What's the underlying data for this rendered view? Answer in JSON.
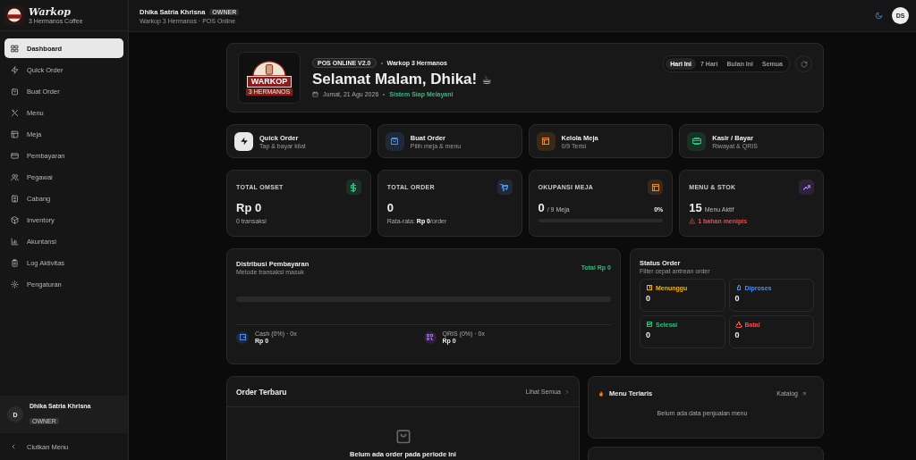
{
  "sidebar": {
    "brand": {
      "title": "Warkop",
      "subtitle": "3 Hermanos Coffee"
    },
    "items": [
      {
        "label": "Dashboard",
        "selected": true
      },
      {
        "label": "Quick Order",
        "selected": false
      },
      {
        "label": "Buat Order",
        "selected": false
      },
      {
        "label": "Menu",
        "selected": false
      },
      {
        "label": "Meja",
        "selected": false
      },
      {
        "label": "Pembayaran",
        "selected": false
      },
      {
        "label": "Pegawai",
        "selected": false
      },
      {
        "label": "Cabang",
        "selected": false
      },
      {
        "label": "Inventory",
        "selected": false
      },
      {
        "label": "Akuntansi",
        "selected": false
      },
      {
        "label": "Log Aktivitas",
        "selected": false
      },
      {
        "label": "Pengaturan",
        "selected": false
      }
    ],
    "user": {
      "initial": "D",
      "name": "Dhika Satria Khrisna",
      "role": "OWNER"
    },
    "collapse": {
      "label": "Ciutkan Menu"
    }
  },
  "header": {
    "name": "Dhika Satria Khrisna",
    "role": "OWNER",
    "subtitle": "Warkop 3 Hermanos · POS Online",
    "avatar": "DS"
  },
  "hero": {
    "logo": {
      "title": "WARKOP",
      "subtitle": "3 HERMANOS"
    },
    "badge": "POS ONLINE V2.0",
    "org": "Warkop 3 Hermanos",
    "greeting": "Selamat Malam, Dhika!",
    "emoji": "☕",
    "date": "Jumat, 21 Agu 2026",
    "status": "Sistem Siap Melayani",
    "ranges": [
      {
        "label": "Hari Ini",
        "selected": true
      },
      {
        "label": "7 Hari",
        "selected": false
      },
      {
        "label": "Bulan Ini",
        "selected": false
      },
      {
        "label": "Semua",
        "selected": false
      }
    ]
  },
  "quick_actions": [
    {
      "title": "Quick Order",
      "subtitle": "Tap & bayar kilat",
      "color": "#e8e8e8"
    },
    {
      "title": "Buat Order",
      "subtitle": "Pilih meja & menu",
      "color": "#4a8ff0"
    },
    {
      "title": "Kelola Meja",
      "subtitle": "0/9 Terisi",
      "color": "#f08a24"
    },
    {
      "title": "Kasir / Bayar",
      "subtitle": "Riwayat & QRIS",
      "color": "#22c07a"
    }
  ],
  "stats": [
    {
      "kind": "plain",
      "label": "TOTAL OMSET",
      "value": "Rp 0",
      "note": "0 transaksi",
      "color": "#22c07a"
    },
    {
      "kind": "average",
      "label": "TOTAL ORDER",
      "value": "0",
      "note": "Rata-rata: **Rp 0**/order",
      "color": "#4a8ff0"
    },
    {
      "kind": "occupancy",
      "label": "OKUPANSI MEJA",
      "value": "0",
      "unit": "/ 9 Meja",
      "percent": "0%",
      "level": 0,
      "color": "#f08a24"
    },
    {
      "kind": "menu",
      "label": "MENU & STOK",
      "value": "15",
      "unit": "Menu Aktif",
      "warning": "1 bahan menipis",
      "color": "#a463f2"
    }
  ],
  "distribution": {
    "title": "Distribusi Pembayaran",
    "subtitle": "Metode transaksi masuk",
    "total": "Total Rp 0",
    "level": 0,
    "methods": [
      {
        "label": "Cash (0%) · 0x",
        "amount": "Rp 0",
        "color": "#4a8ff0"
      },
      {
        "label": "QRIS (0%) · 0x",
        "amount": "Rp 0",
        "color": "#a463f2"
      }
    ]
  },
  "status_order": {
    "title": "Status Order",
    "subtitle": "Filter cepat antrean order",
    "items": [
      {
        "label": "Menunggu",
        "value": "0",
        "color": "#f5b400"
      },
      {
        "label": "Diproses",
        "value": "0",
        "color": "#4a8ff0"
      },
      {
        "label": "Selesai",
        "value": "0",
        "color": "#22c07a"
      },
      {
        "label": "Batal",
        "value": "0",
        "color": "#f04a4a"
      }
    ]
  },
  "recent_orders": {
    "title": "Order Terbaru",
    "link": "Lihat Semua",
    "empty": "Belum ada order pada periode ini"
  },
  "top_menu": {
    "title": "Menu Terlaris",
    "link": "Katalog",
    "empty": "Belum ada data penjualan menu"
  }
}
